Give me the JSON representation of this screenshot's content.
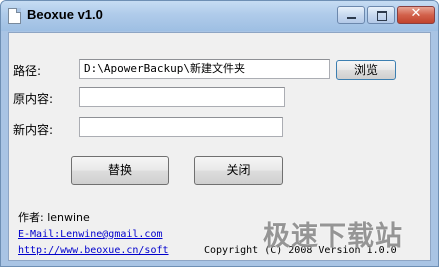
{
  "window": {
    "title": "Beoxue v1.0",
    "close_glyph": "✕"
  },
  "form": {
    "path_label": "路径:",
    "path_value": "D:\\ApowerBackup\\新建文件夹",
    "browse_label": "浏览",
    "original_label": "原内容:",
    "original_value": "",
    "new_label": "新内容:",
    "new_value": "",
    "replace_label": "替换",
    "close_label": "关闭"
  },
  "footer": {
    "author": "作者: lenwine",
    "email": "E-Mail:Lenwine@gmail.com",
    "website": "http://www.beoxue.cn/soft",
    "copyright": "Copyright (C) 2008 Version 1.0.0"
  },
  "watermark": "极速下载站",
  "icons": [
    "app-icon",
    "minimize-icon",
    "maximize-icon",
    "close-icon"
  ]
}
